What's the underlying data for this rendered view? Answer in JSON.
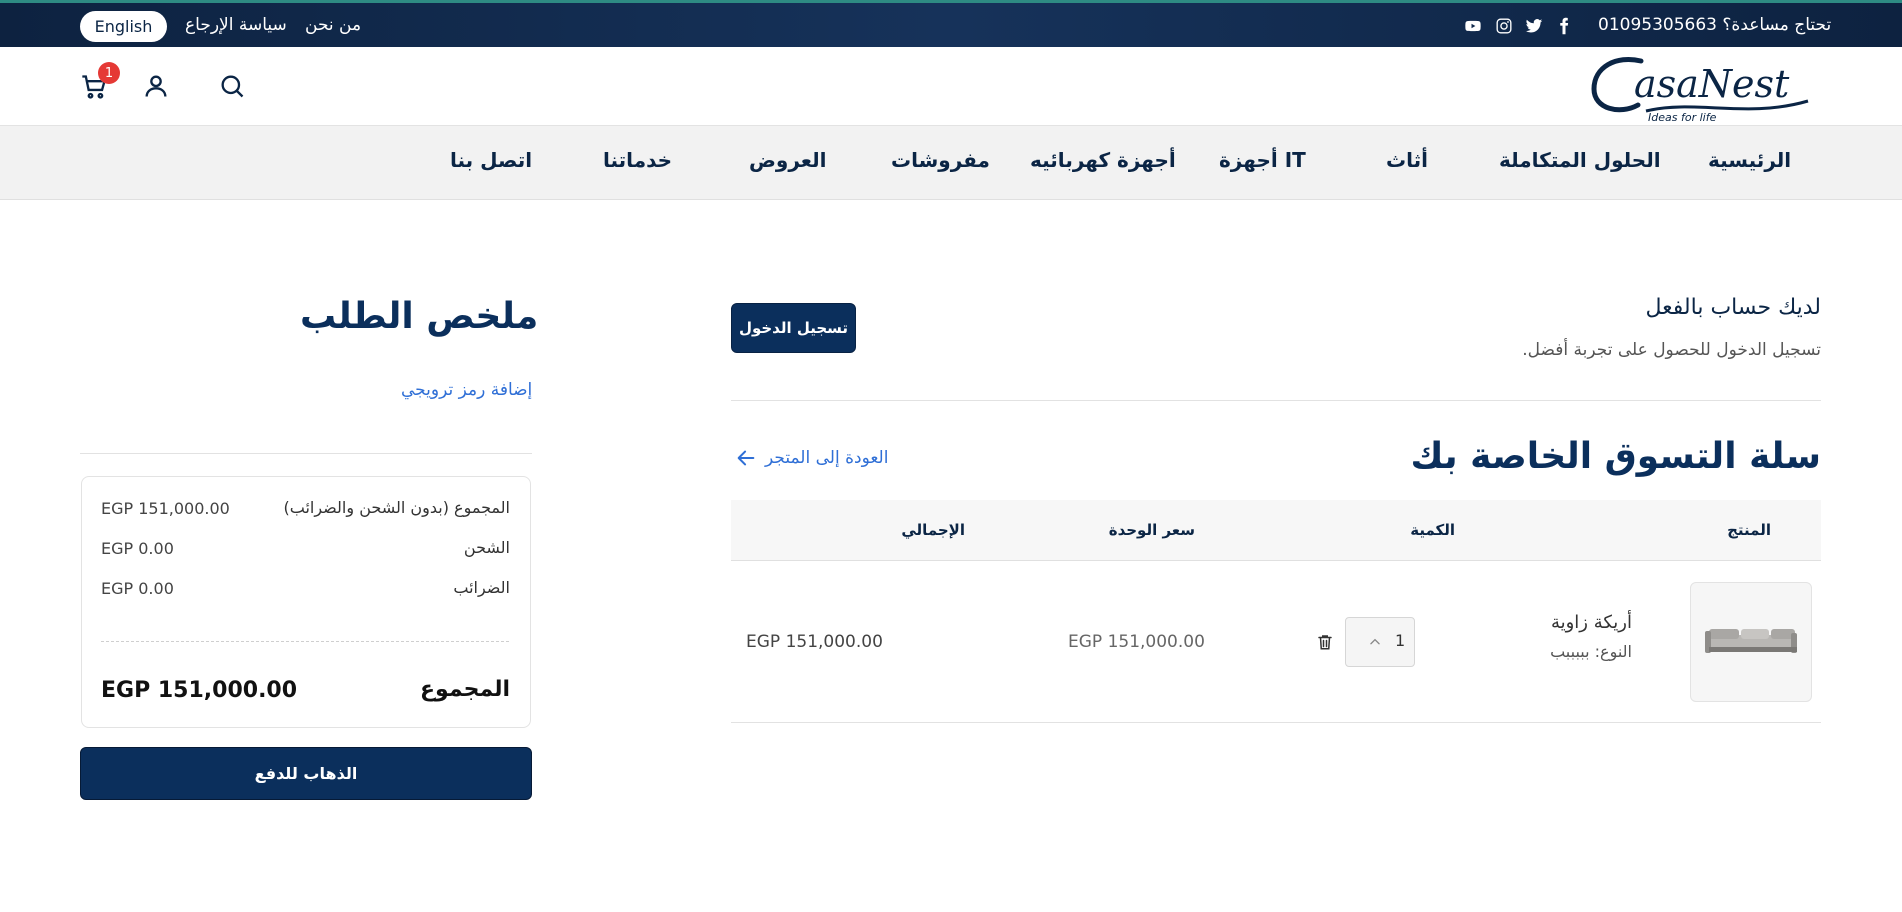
{
  "topbar": {
    "language_button": "English",
    "about_link": "من نحن",
    "return_policy_link": "سياسة الإرجاع",
    "help_text": "تحتاج مساعدة؟ 01095305663",
    "social_icons": [
      "youtube-icon",
      "instagram-icon",
      "twitter-icon",
      "facebook-icon"
    ]
  },
  "header": {
    "logo_text": "CasaNest",
    "logo_tagline": "Ideas for life",
    "cart_count": "1"
  },
  "nav": {
    "items": [
      "الرئيسية",
      "الحلول المتكاملة",
      "أثاث",
      "أجهزة IT",
      "أجهزة كهربائيه",
      "مفروشات",
      "العروض",
      "خدماتنا",
      "اتصل بنا"
    ]
  },
  "account": {
    "title": "لديك حساب بالفعل",
    "subtitle": "تسجيل الدخول للحصول على تجربة أفضل.",
    "login_button": "تسجيل الدخول"
  },
  "cart": {
    "title": "سلة التسوق الخاصة بك",
    "back_link": "العودة إلى المتجر",
    "columns": [
      "المنتج",
      "الكمية",
      "سعر الوحدة",
      "الإجمالي"
    ],
    "items": [
      {
        "name": "أريكة زاوية",
        "variant": "النوع: بببببب",
        "quantity": "1",
        "unit_price": "EGP 151,000.00",
        "total": "EGP 151,000.00"
      }
    ]
  },
  "summary": {
    "title": "ملخص الطلب",
    "promo_link": "إضافة رمز ترويجي",
    "subtotal_label": "المجموع (بدون الشحن والضرائب)",
    "subtotal_value": "EGP 151,000.00",
    "shipping_label": "الشحن",
    "shipping_value": "EGP 0.00",
    "taxes_label": "الضرائب",
    "taxes_value": "EGP 0.00",
    "total_label": "المجموع",
    "total_value": "EGP 151,000.00",
    "checkout_button": "الذهاب للدفع"
  },
  "colors": {
    "primary": "#0b2f5c",
    "link": "#2f6fd6",
    "badge": "#e53935"
  }
}
